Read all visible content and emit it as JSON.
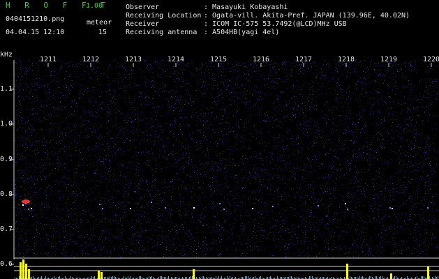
{
  "header": {
    "brand": "H R O F F T",
    "version": "1.00",
    "filename": "0404151210.png",
    "meteor_label": "meteor",
    "datetime": "04.04.15 12:10",
    "meteor_count": "15"
  },
  "info": [
    {
      "label": "Observer",
      "value": ": Masayuki Kobayashi"
    },
    {
      "label": "Receiving Location",
      "value": ": Ogata-vill. Akita-Pref. JAPAN (139.96E, 40.02N)"
    },
    {
      "label": "Receiver",
      "value": ": ICOM IC-575 53.7492(@LCD)MHz USB"
    },
    {
      "label": "Receiving antenna",
      "value": ": A504HB(yagi 4el)"
    }
  ],
  "axis": {
    "y_unit": "kHz",
    "y_ticks": [
      "1.1",
      "1.0",
      "0.9",
      "0.8",
      "0.7",
      "0.6"
    ],
    "x_ticks": [
      "1211",
      "1212",
      "1213",
      "1214",
      "1215",
      "1216",
      "1217",
      "1218",
      "1219",
      "1220"
    ]
  },
  "colors": {
    "background": "#000000",
    "spectrogram_noise": "#1a1a8c",
    "grid": "#cfcfcf",
    "text": "#e8e8e8",
    "brand": "#39d63a",
    "histogram": "#ffff00",
    "histogram_low": "#33c8e8"
  }
}
